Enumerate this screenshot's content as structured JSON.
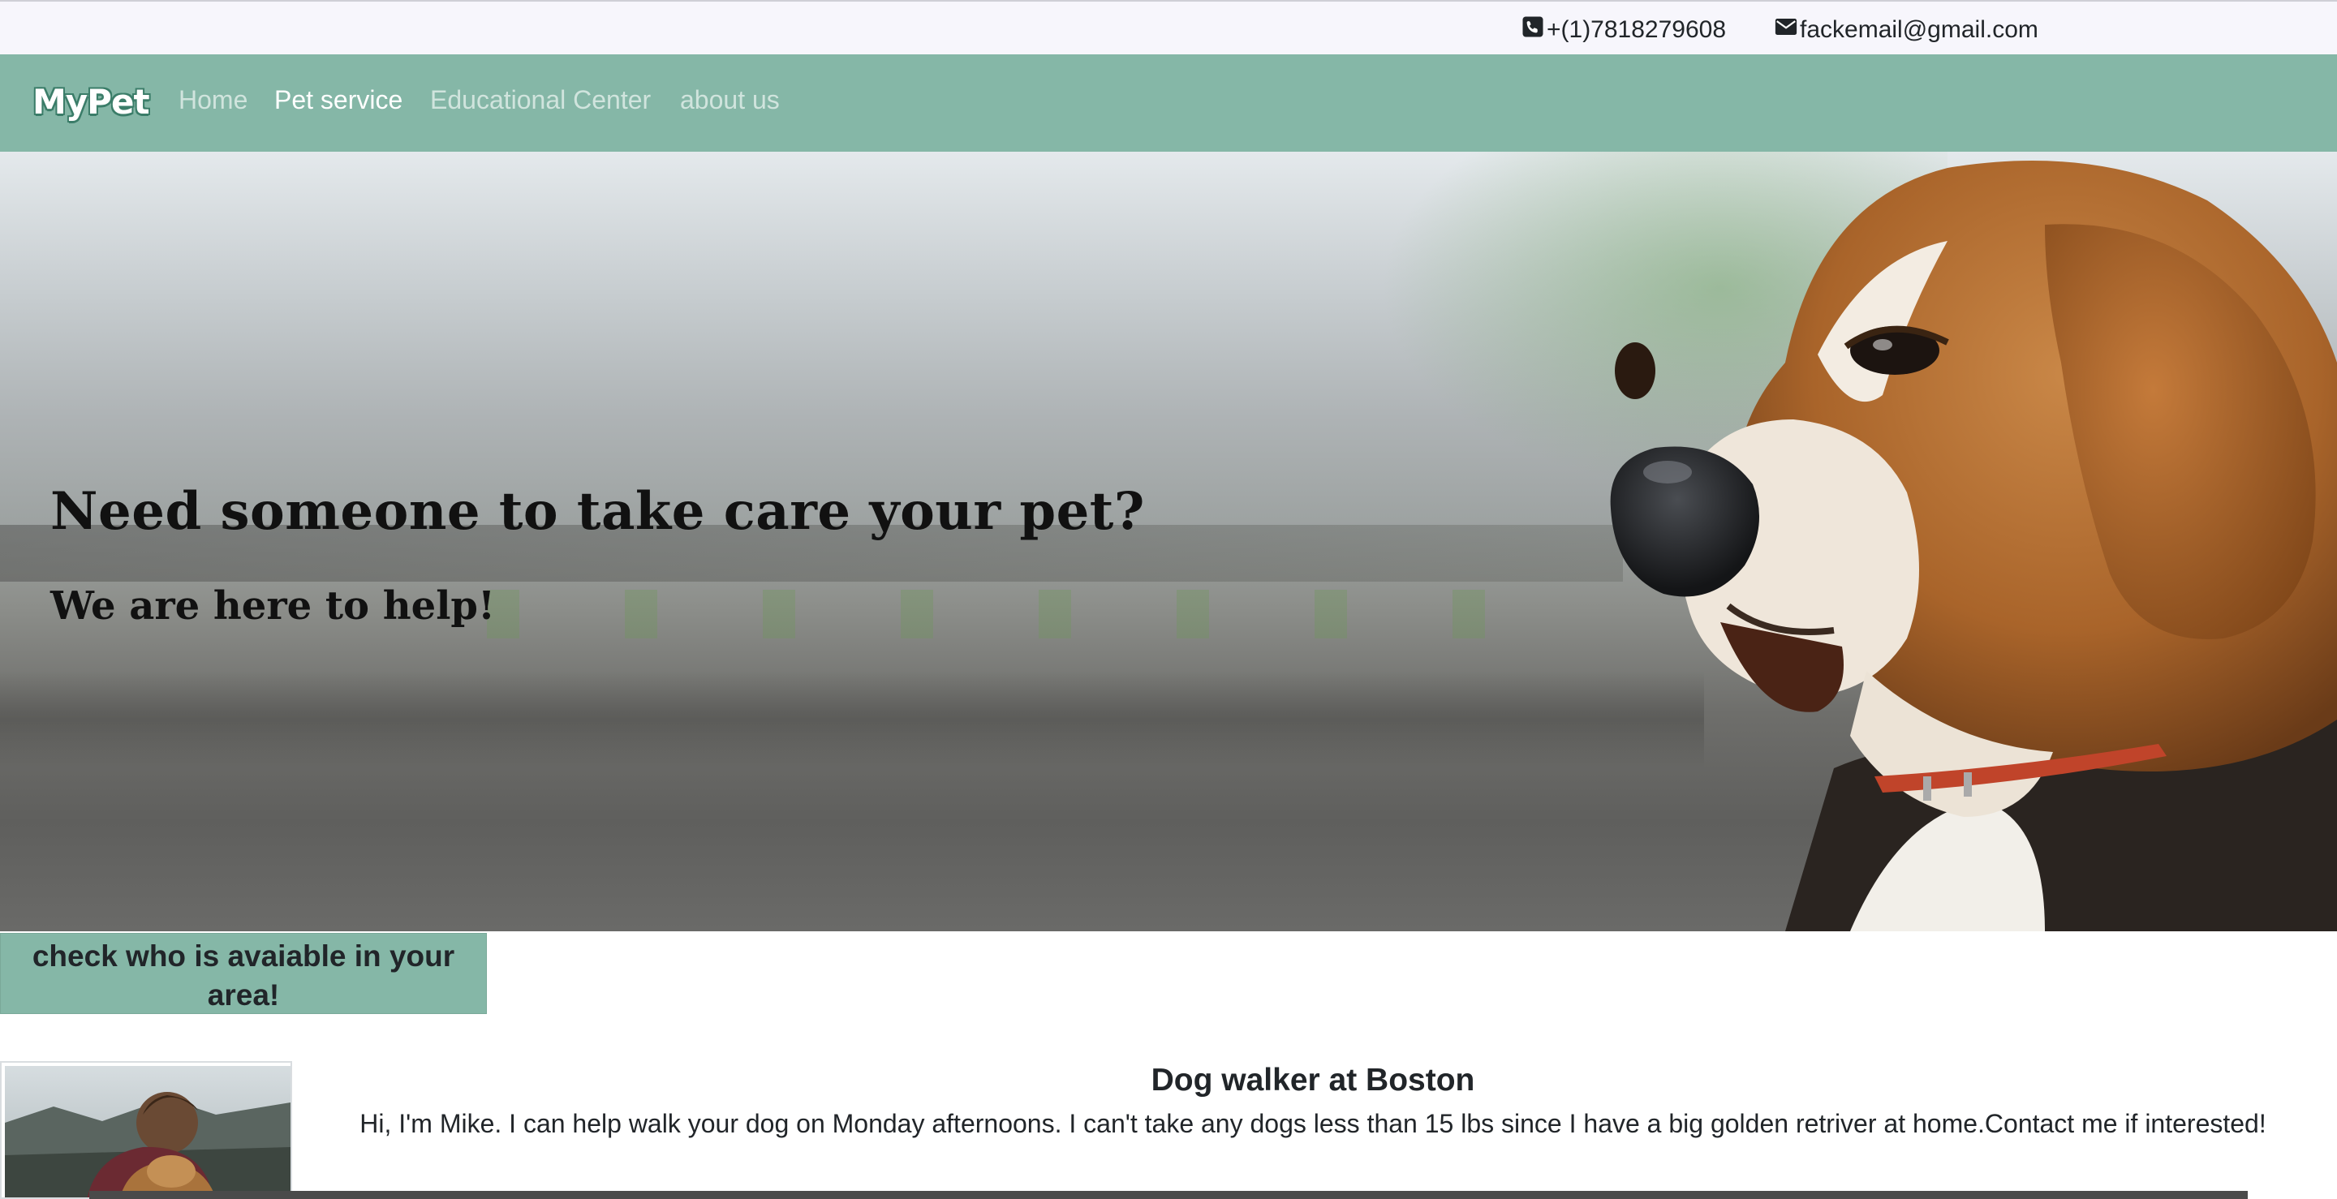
{
  "contact": {
    "phone": "+(1)7818279608",
    "email": "fackemail@gmail.com",
    "phone_icon": "phone-icon",
    "email_icon": "envelope-icon"
  },
  "navbar": {
    "brand": "MyPet",
    "items": [
      {
        "label": "Home",
        "active": false
      },
      {
        "label": "Pet service",
        "active": true
      },
      {
        "label": "Educational Center",
        "active": false
      },
      {
        "label": "about us",
        "active": false
      }
    ],
    "background": "#85b7a7"
  },
  "hero": {
    "title": "Need someone to take care your pet?",
    "subtitle": "We are here to help!",
    "image": "beagle-photo"
  },
  "cta": {
    "label": "check who is avaiable in your area!"
  },
  "listing": {
    "title": "Dog walker at Boston",
    "text": "Hi, I'm Mike. I can help walk your dog on Monday afternoons. I can't take any dogs less than 15 lbs since I have a big golden retriver at home.Contact me if interested!",
    "image": "walker-with-dog-photo"
  }
}
